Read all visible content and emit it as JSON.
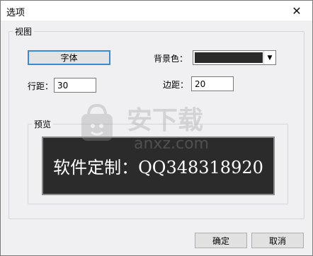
{
  "window": {
    "title": "选项",
    "close_glyph": "✕"
  },
  "view_group": {
    "legend": "视图",
    "font_button": "字体",
    "bg_label": "背景色：",
    "bg_color": "#2b2b2b",
    "line_spacing_label": "行距：",
    "line_spacing_value": "30",
    "margin_label": "边距：",
    "margin_value": "20"
  },
  "preview_group": {
    "legend": "预览",
    "text": "软件定制：QQ348318920"
  },
  "watermark": {
    "brand": "安下载",
    "domain": "anxz.com"
  },
  "footer": {
    "ok_label": "确定",
    "cancel_label": "取消"
  }
}
